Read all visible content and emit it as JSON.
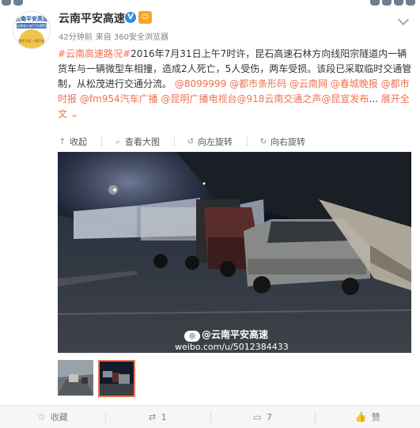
{
  "top_icons": [
    "game-icon",
    "game-icon",
    "game-icon"
  ],
  "account": {
    "name": "云南平安高速",
    "avatar_line1": "云南平安高速",
    "avatar_line2": "云南省公安厅交通警察总队",
    "avatar_line3": "服务与您 一路平安",
    "verified_icon": "V",
    "medal_icon": "☺"
  },
  "meta": {
    "time": "42分钟前",
    "source": "来自 360安全浏览器"
  },
  "post": {
    "segments": [
      {
        "text": "#云南高速路况#",
        "link": true
      },
      {
        "text": "2016年7月31日上午7时许，昆石高速石林方向线阳宗隧道内一辆货车与一辆微型车相撞，造成2人死亡，5人受伤，两车受损。该段已采取临时交通管制，从松茂进行交通分流。 ",
        "link": false
      },
      {
        "text": "@8099999",
        "link": true
      },
      {
        "text": " ",
        "link": false
      },
      {
        "text": "@都市条形码",
        "link": true
      },
      {
        "text": " ",
        "link": false
      },
      {
        "text": "@云南网",
        "link": true
      },
      {
        "text": " ",
        "link": false
      },
      {
        "text": "@春城晚报",
        "link": true
      },
      {
        "text": " ",
        "link": false
      },
      {
        "text": "@都市时报",
        "link": true
      },
      {
        "text": " ",
        "link": false
      },
      {
        "text": "@fm954汽车广播",
        "link": true
      },
      {
        "text": " ",
        "link": false
      },
      {
        "text": "@昆明广播电视台",
        "link": true
      },
      {
        "text": "",
        "link": false
      },
      {
        "text": "@918云南交通之声",
        "link": true
      },
      {
        "text": "",
        "link": false
      },
      {
        "text": "@昆宣发布",
        "link": true
      },
      {
        "text": "... ",
        "link": false
      },
      {
        "text": "展开全文 ",
        "link": true
      },
      {
        "text": "⌄",
        "link": true
      }
    ]
  },
  "media_toolbar": {
    "collapse": "收起",
    "view_large": "查看大图",
    "rotate_left": "向左旋转",
    "rotate_right": "向右旋转"
  },
  "watermark": {
    "handle": "@云南平安高速",
    "url": "weibo.com/u/5012384433"
  },
  "actions": {
    "favorite": "收藏",
    "repost": "1",
    "comment": "7",
    "like": "赞"
  }
}
